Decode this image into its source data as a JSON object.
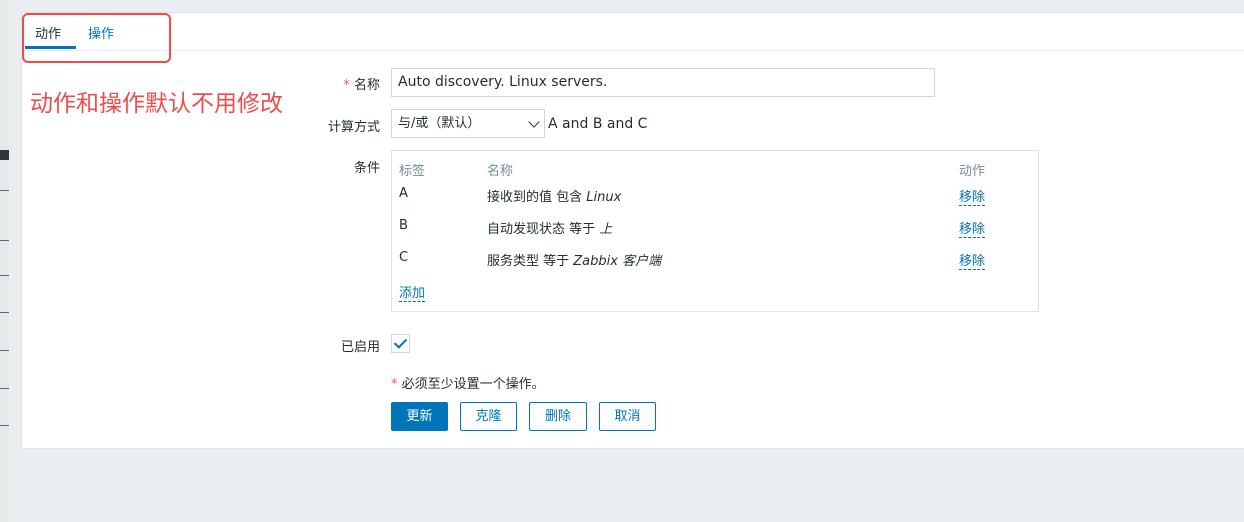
{
  "tabs": [
    {
      "label": "动作"
    },
    {
      "label": "操作"
    }
  ],
  "annotation": {
    "text": "动作和操作默认不用修改",
    "color": "#ef4c4c"
  },
  "form": {
    "name": {
      "required_mark": "*",
      "label": "名称",
      "value": "Auto discovery. Linux servers."
    },
    "calc": {
      "label": "计算方式",
      "selected": "与/或（默认）",
      "formula": "A and B and C"
    },
    "conditions": {
      "label": "条件",
      "headers": {
        "tag": "标签",
        "name": "名称",
        "action": "动作"
      },
      "rows": [
        {
          "tag": "A",
          "text": "接收到的值 包含 ",
          "value": "Linux",
          "action": "移除"
        },
        {
          "tag": "B",
          "text": "自动发现状态 等于 ",
          "value": "上",
          "action": "移除"
        },
        {
          "tag": "C",
          "text": "服务类型 等于 ",
          "value": "Zabbix 客户端",
          "action": "移除"
        }
      ],
      "add_label": "添加"
    },
    "enabled": {
      "label": "已启用",
      "checked": true
    },
    "note": {
      "mark": "*",
      "text": "必须至少设置一个操作。"
    }
  },
  "buttons": {
    "update": "更新",
    "clone": "克隆",
    "delete": "删除",
    "cancel": "取消"
  },
  "colors": {
    "accent": "#0275b8",
    "required": "#e45959",
    "annotation": "#ef4c4c"
  }
}
